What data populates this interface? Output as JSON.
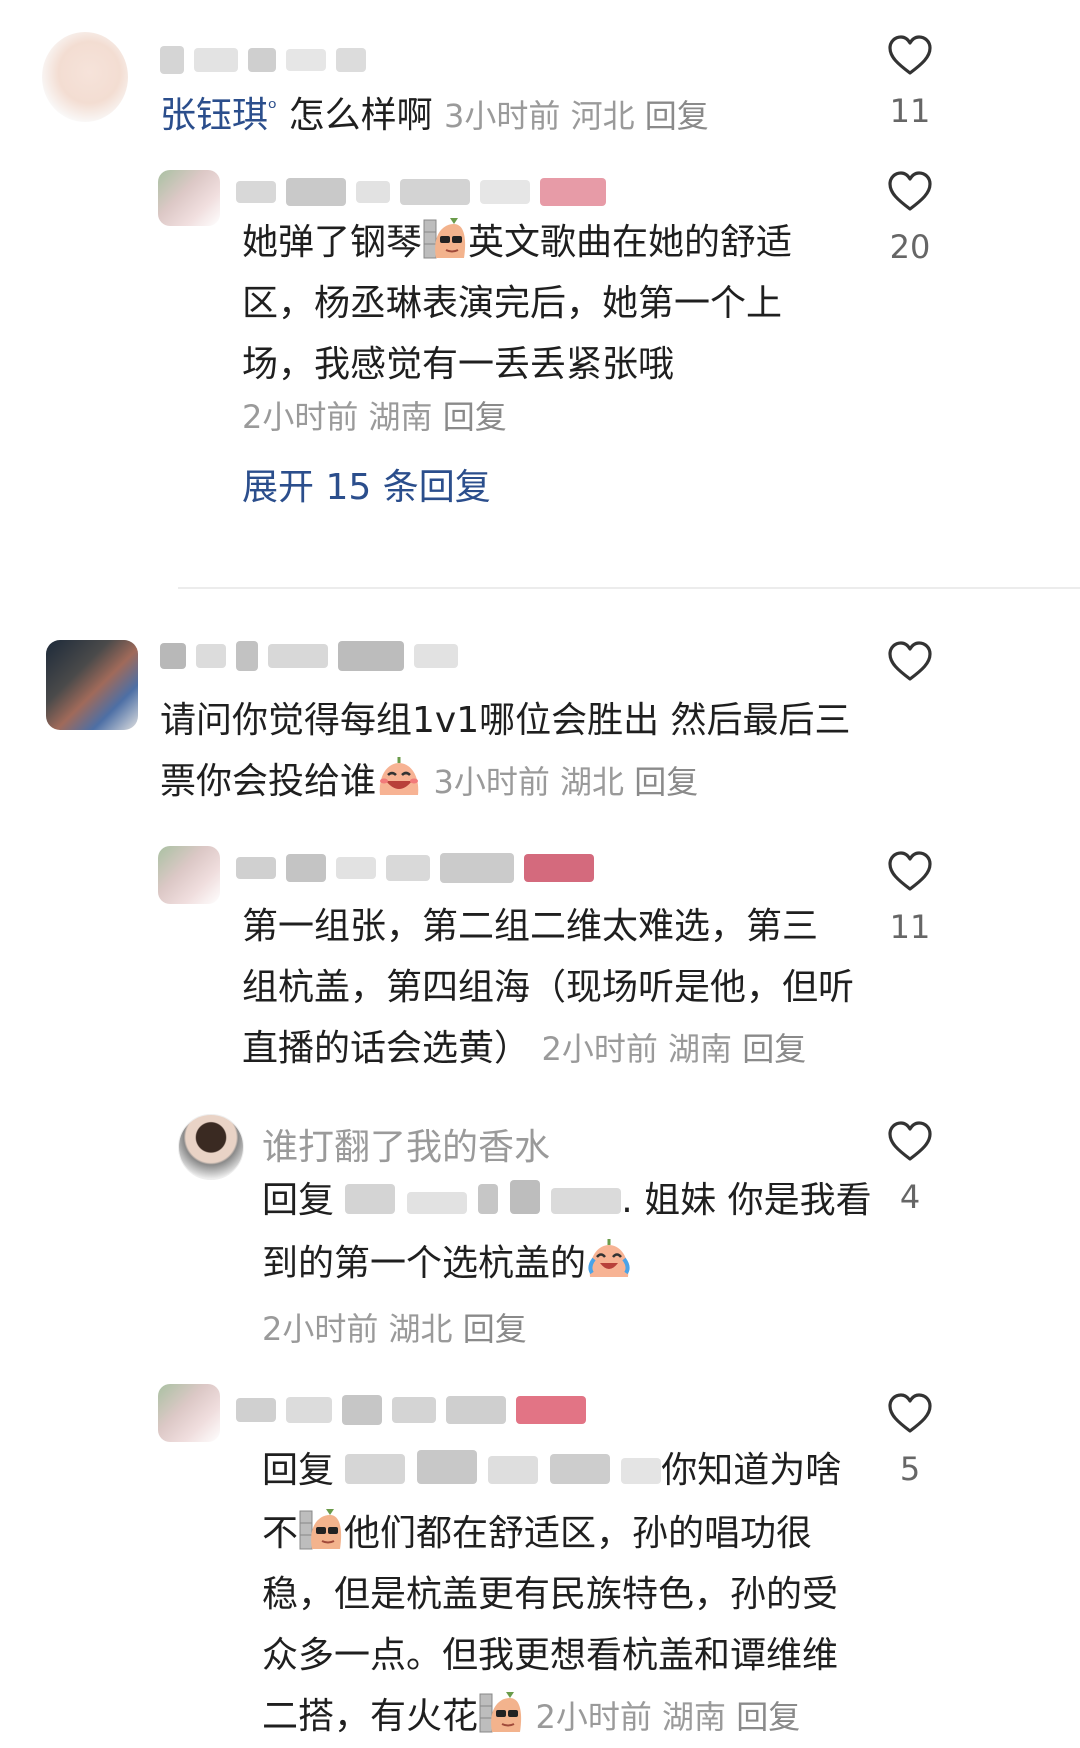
{
  "comments": [
    {
      "mention": "张钰琪",
      "mention_suffix": "ᵒ",
      "text": "怎么样啊",
      "time": "3小时前",
      "location": "河北",
      "reply_label": "回复",
      "likes": "11"
    },
    {
      "text_lines": [
        "她弹了钢琴",
        "英文歌曲在她的舒适",
        "区，杨丞琳表演完后，她第一个上",
        "场，我感觉有一丢丢紧张哦"
      ],
      "time": "2小时前",
      "location": "湖南",
      "reply_label": "回复",
      "likes": "20",
      "expand_label": "展开 15 条回复"
    },
    {
      "text_lines": [
        "请问你觉得每组1v1哪位会胜出 然后最后三",
        "票你会投给谁"
      ],
      "time": "3小时前",
      "location": "湖北",
      "reply_label": "回复",
      "likes": ""
    },
    {
      "text_lines": [
        "第一组张，第二组二维太难选，第三",
        "组杭盖，第四组海（现场听是他，但听",
        "直播的话会选黄）"
      ],
      "time": "2小时前",
      "location": "湖南",
      "reply_label": "回复",
      "likes": "11"
    },
    {
      "username": "谁打翻了我的香水",
      "reply_prefix": "回复",
      "text_line1_tail": ". 姐妹 你是我看",
      "text_line2": "到的第一个选杭盖的",
      "time": "2小时前",
      "location": "湖北",
      "reply_label": "回复",
      "likes": "4"
    },
    {
      "reply_prefix": "回复",
      "text_line1_tail": "你知道为啥",
      "text_line2_a": "不",
      "text_line2_b": "他们都在舒适区，孙的唱功很",
      "text_line3": "稳，但是杭盖更有民族特色，孙的受",
      "text_line4": "众多一点。但我更想看杭盖和谭维维",
      "text_line5": "二搭，有火花",
      "time": "2小时前",
      "location": "湖南",
      "reply_label": "回复",
      "likes": "5"
    }
  ],
  "colors": {
    "mention": "#2b4e8c",
    "meta": "#9a9a9a",
    "expand": "#2b4e8c"
  },
  "icons": {
    "like": "heart-outline-icon",
    "emoji_sunglasses": "sunglasses-emoji-icon",
    "emoji_laugh": "laugh-emoji-icon",
    "emoji_cry_laugh": "cry-laugh-emoji-icon"
  }
}
